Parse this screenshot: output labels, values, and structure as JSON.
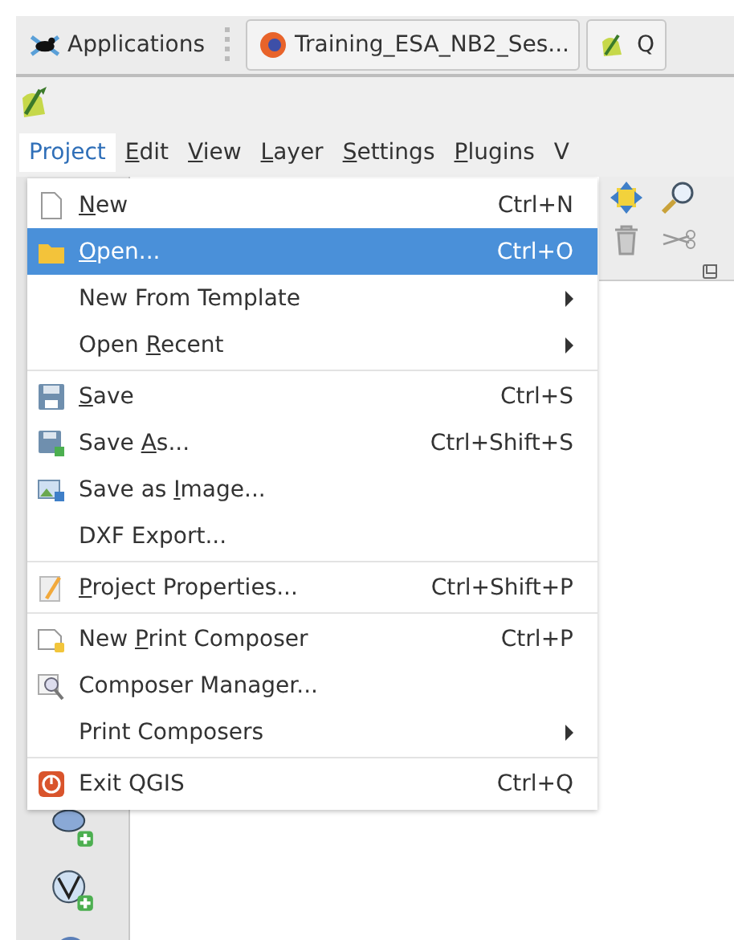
{
  "taskbar": {
    "applications": "Applications",
    "tasks": [
      {
        "label": "Training_ESA_NB2_Ses...",
        "kind": "browser",
        "selected": false
      },
      {
        "label": "Q",
        "kind": "qgis",
        "selected": false
      }
    ]
  },
  "menubar": [
    {
      "label": "Project",
      "selected": true
    },
    {
      "label": {
        "key": "E",
        "after": "dit"
      },
      "selected": false
    },
    {
      "label": {
        "key": "V",
        "after": "iew"
      },
      "selected": false
    },
    {
      "label": {
        "key": "L",
        "after": "ayer"
      },
      "selected": false
    },
    {
      "label": {
        "key": "S",
        "after": "ettings"
      },
      "selected": false
    },
    {
      "label": {
        "key": "P",
        "after": "lugins"
      },
      "selected": false
    },
    {
      "label": "V",
      "selected": false
    }
  ],
  "menu": [
    {
      "kind": "item",
      "label": {
        "key": "N",
        "after": "ew"
      },
      "shortcut": "Ctrl+N",
      "selected": false,
      "submenu": false
    },
    {
      "kind": "item",
      "label": {
        "key": "O",
        "after": "pen..."
      },
      "shortcut": "Ctrl+O",
      "selected": true,
      "submenu": false
    },
    {
      "kind": "item",
      "label": "New From Template",
      "selected": false,
      "submenu": true
    },
    {
      "kind": "item",
      "label": {
        "before": "Open ",
        "key": "R",
        "after": "ecent"
      },
      "selected": false,
      "submenu": true
    },
    {
      "kind": "separator"
    },
    {
      "kind": "item",
      "label": {
        "key": "S",
        "after": "ave"
      },
      "shortcut": "Ctrl+S",
      "selected": false,
      "submenu": false
    },
    {
      "kind": "item",
      "label": {
        "before": "Save ",
        "key": "A",
        "after": "s..."
      },
      "shortcut": "Ctrl+Shift+S",
      "selected": false,
      "submenu": false
    },
    {
      "kind": "item",
      "label": {
        "before": "Save as ",
        "key": "I",
        "after": "mage..."
      },
      "selected": false,
      "submenu": false
    },
    {
      "kind": "item",
      "label": "DXF Export...",
      "selected": false,
      "submenu": false
    },
    {
      "kind": "separator"
    },
    {
      "kind": "item",
      "label": {
        "key": "P",
        "after": "roject Properties..."
      },
      "shortcut": "Ctrl+Shift+P",
      "selected": false,
      "submenu": false
    },
    {
      "kind": "separator"
    },
    {
      "kind": "item",
      "label": {
        "before": "New ",
        "key": "P",
        "after": "rint Composer"
      },
      "shortcut": "Ctrl+P",
      "selected": false,
      "submenu": false
    },
    {
      "kind": "item",
      "label": "Composer Manager...",
      "selected": false,
      "submenu": false
    },
    {
      "kind": "item",
      "label": "Print Composers",
      "selected": false,
      "submenu": true
    },
    {
      "kind": "separator"
    },
    {
      "kind": "item",
      "label": "Exit QGIS",
      "shortcut": "Ctrl+Q",
      "selected": false,
      "submenu": false
    }
  ]
}
